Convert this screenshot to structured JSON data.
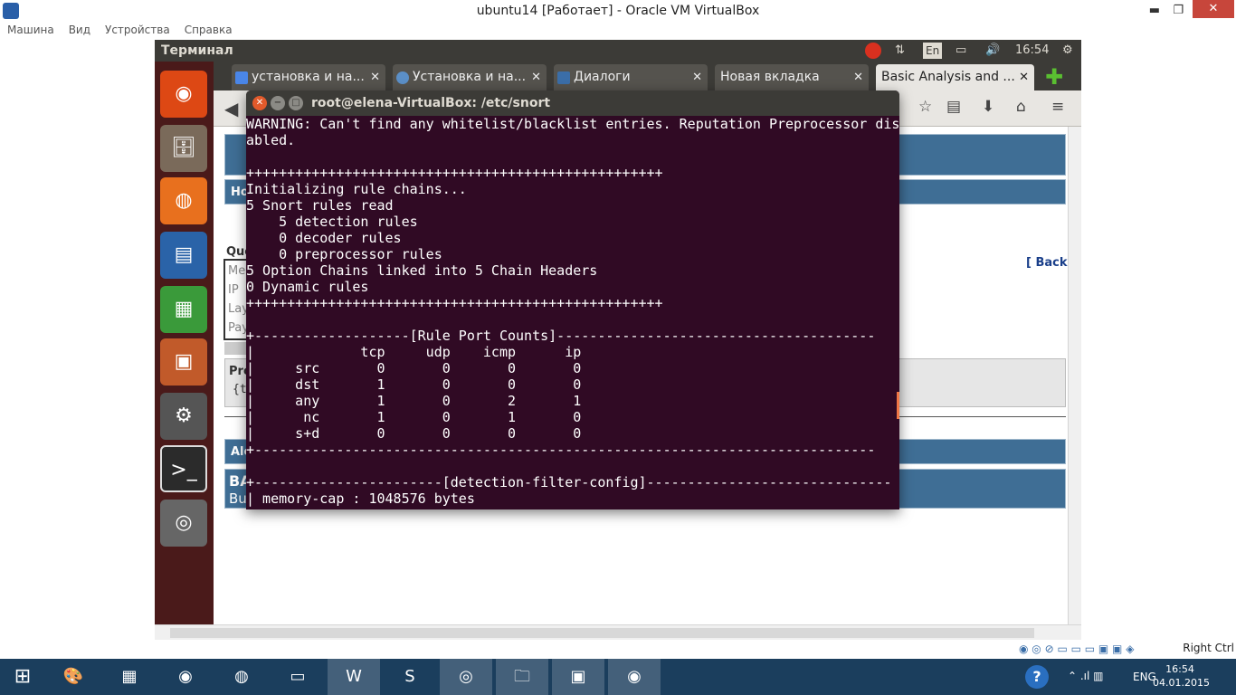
{
  "host": {
    "title": "ubuntu14 [Работает] - Oracle VM VirtualBox",
    "minimize": "▬",
    "restore": "❐",
    "close": "✕",
    "menu": [
      "Машина",
      "Вид",
      "Устройства",
      "Справка"
    ],
    "status_right": "Right Ctrl"
  },
  "ubuntu": {
    "panel_title": "Терминал",
    "keyboard": "En",
    "time": "16:54"
  },
  "browser": {
    "tabs": [
      {
        "label": "установка и на...",
        "icon_color": "#4a86e8"
      },
      {
        "label": "Установка и на...",
        "icon_color": "#5b8fc7"
      },
      {
        "label": "Диалоги",
        "icon_color": "#3b6ea8"
      },
      {
        "label": "Новая вкладка",
        "icon_color": ""
      },
      {
        "label": "Basic Analysis and ...",
        "icon_color": ""
      }
    ],
    "tab_close": "✕",
    "new_tab": "✚",
    "page": {
      "back_link": "[ Back",
      "frag_ho": "Ho",
      "frag_que": "Que",
      "frag_me": "Me",
      "frag_ip": "IP",
      "frag_lay": "Lay",
      "frag_pay": "Pay",
      "frag_pro": "Pro",
      "frag_brace": "{t",
      "frag_alo": "Alo",
      "frag_ba": "BA",
      "frag_bu": "Bu"
    }
  },
  "terminal": {
    "title": "root@elena-VirtualBox: /etc/snort",
    "lines": [
      "WARNING: Can't find any whitelist/blacklist entries. Reputation Preprocessor dis",
      "abled.",
      "",
      "+++++++++++++++++++++++++++++++++++++++++++++++++++",
      "Initializing rule chains...",
      "5 Snort rules read",
      "    5 detection rules",
      "    0 decoder rules",
      "    0 preprocessor rules",
      "5 Option Chains linked into 5 Chain Headers",
      "0 Dynamic rules",
      "+++++++++++++++++++++++++++++++++++++++++++++++++++",
      "",
      "+-------------------[Rule Port Counts]---------------------------------------",
      "|             tcp     udp    icmp      ip",
      "|     src       0       0       0       0",
      "|     dst       1       0       0       0",
      "|     any       1       0       2       1",
      "|      nc       1       0       1       0",
      "|     s+d       0       0       0       0",
      "+----------------------------------------------------------------------------",
      "",
      "+-----------------------[detection-filter-config]------------------------------",
      "| memory-cap : 1048576 bytes"
    ]
  },
  "taskbar": {
    "lang": "ENG",
    "time": "16:54",
    "date": "04.01.2015"
  },
  "colors": {
    "terminal_bg": "#300a24",
    "launcher_bg": "#4a1a1a",
    "panel_bg": "#3c3b37",
    "taskbar_bg": "#1b3e5d",
    "banner": "#3f6e95"
  }
}
